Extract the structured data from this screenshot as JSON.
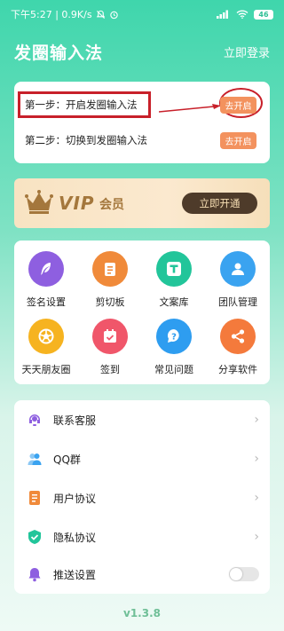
{
  "status_bar": {
    "time_network": "下午5:27 | 0.9K/s",
    "signal": "4G",
    "battery": "46"
  },
  "header": {
    "title": "发圈输入法",
    "login_label": "立即登录"
  },
  "steps": [
    {
      "label": "第一步：开启发圈输入法",
      "button": "去开启"
    },
    {
      "label": "第二步：切换到发圈输入法",
      "button": "去开启"
    }
  ],
  "vip": {
    "badge": "VIP",
    "member_label": "会员",
    "button": "立即开通"
  },
  "grid": [
    {
      "label": "签名设置",
      "icon": "feather-icon",
      "color": "#8e5fe0"
    },
    {
      "label": "剪切板",
      "icon": "clipboard-icon",
      "color": "#f08a3a"
    },
    {
      "label": "文案库",
      "icon": "text-t-icon",
      "color": "#22c59a"
    },
    {
      "label": "团队管理",
      "icon": "team-user-icon",
      "color": "#3aa3f0"
    },
    {
      "label": "天天朋友圈",
      "icon": "aperture-icon",
      "color": "#f6b320"
    },
    {
      "label": "签到",
      "icon": "calendar-check-icon",
      "color": "#f0566a"
    },
    {
      "label": "常见问题",
      "icon": "question-icon",
      "color": "#2e9df0"
    },
    {
      "label": "分享软件",
      "icon": "share-icon",
      "color": "#f47a3c"
    }
  ],
  "menu": [
    {
      "label": "联系客服",
      "icon": "headset-icon",
      "color": "#8e5fe0"
    },
    {
      "label": "QQ群",
      "icon": "qq-group-icon",
      "color": "#3aa3f0"
    },
    {
      "label": "用户协议",
      "icon": "document-icon",
      "color": "#f08a3a"
    },
    {
      "label": "隐私协议",
      "icon": "shield-check-icon",
      "color": "#22c59a"
    },
    {
      "label": "推送设置",
      "icon": "bell-icon",
      "color": "#8e5fe0"
    }
  ],
  "version": "v1.3.8"
}
